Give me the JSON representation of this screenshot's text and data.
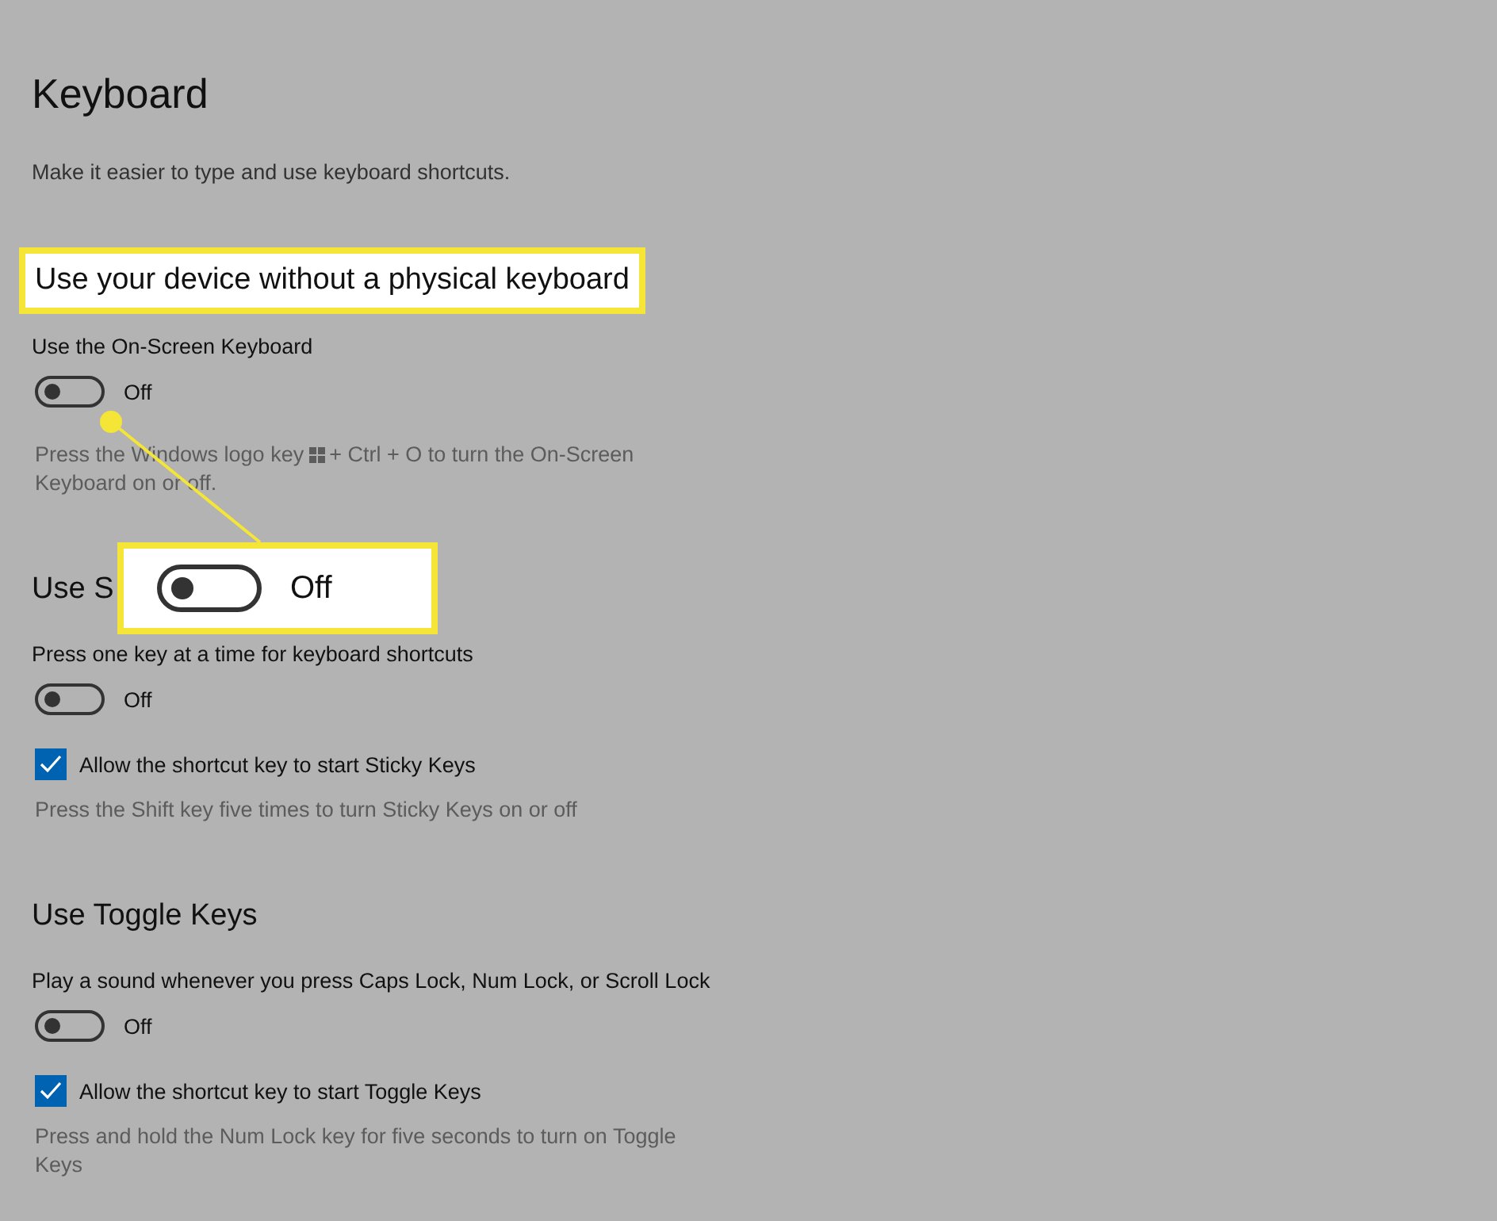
{
  "title": "Keyboard",
  "subtitle": "Make it easier to type and use keyboard shortcuts.",
  "sections": [
    {
      "heading": "Use your device without a physical keyboard",
      "highlighted": true,
      "items": [
        {
          "kind": "toggle",
          "label": "Use the On-Screen Keyboard",
          "on": false,
          "state_text": "Off"
        },
        {
          "kind": "note_with_icon",
          "before": "Press the Windows logo key",
          "after": "+ Ctrl + O to turn the On-Screen",
          "continued": "Keyboard on or off."
        }
      ]
    },
    {
      "heading": "Use S",
      "highlighted": false,
      "items": [
        {
          "kind": "toggle",
          "label": "Press one key at a time for keyboard shortcuts",
          "on": false,
          "state_text": "Off"
        },
        {
          "kind": "checkbox",
          "label": "Allow the shortcut key to start Sticky Keys",
          "checked": true
        },
        {
          "kind": "note",
          "text": "Press the Shift key five times to turn Sticky Keys on or off"
        }
      ]
    },
    {
      "heading": "Use Toggle Keys",
      "highlighted": false,
      "items": [
        {
          "kind": "toggle",
          "label": "Play a sound whenever you press Caps Lock, Num Lock, or Scroll Lock",
          "on": false,
          "state_text": "Off"
        },
        {
          "kind": "checkbox",
          "label": "Allow the shortcut key to start Toggle Keys",
          "checked": true
        },
        {
          "kind": "note",
          "text": "Press and hold the Num Lock key for five seconds to turn on Toggle Keys"
        }
      ]
    }
  ],
  "callout": {
    "on": false,
    "state_text": "Off"
  }
}
